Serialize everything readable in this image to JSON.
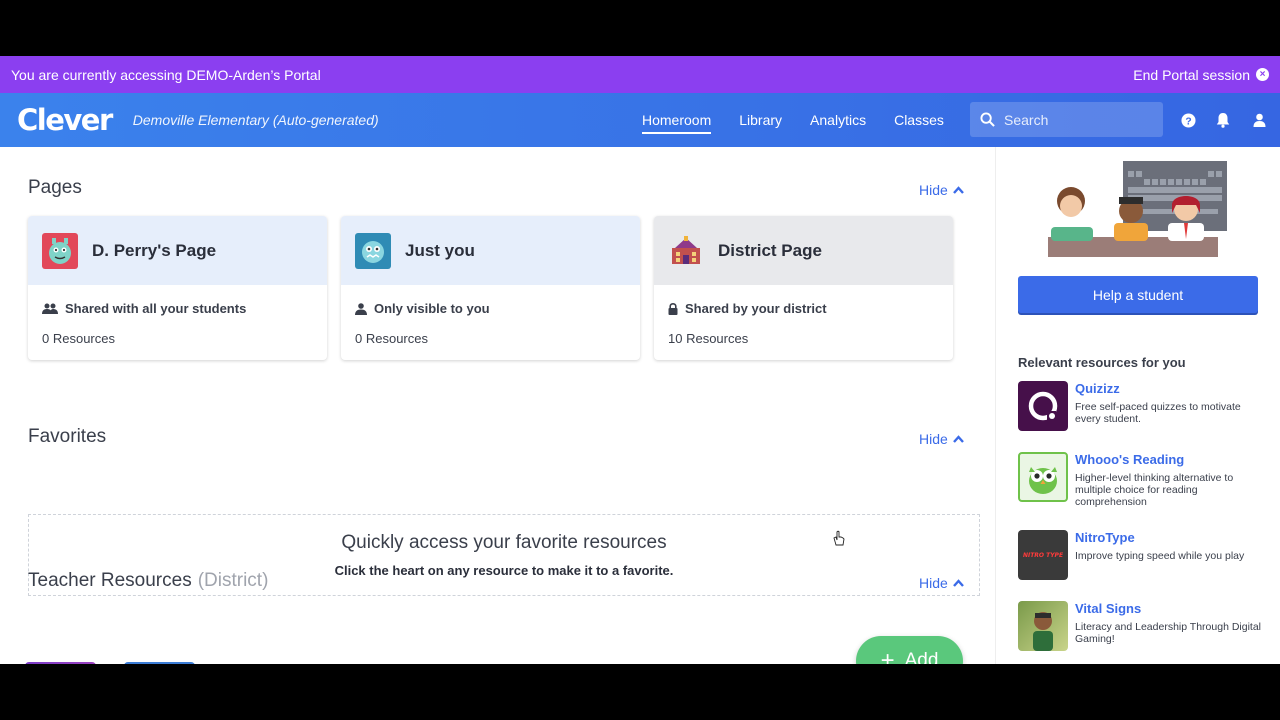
{
  "portal_bar": {
    "message": "You are currently accessing DEMO-Arden’s Portal",
    "end_label": "End Portal session"
  },
  "navbar": {
    "logo": "Clever",
    "district": "Demoville Elementary (Auto-generated)",
    "links": [
      "Homeroom",
      "Library",
      "Analytics",
      "Classes"
    ],
    "active_link": "Homeroom",
    "search_placeholder": "Search",
    "icons": [
      "help-icon",
      "bell-icon",
      "user-icon"
    ]
  },
  "pages": {
    "title": "Pages",
    "hide_label": "Hide",
    "cards": [
      {
        "title": "D. Perry's Page",
        "visibility": "Shared with all your students",
        "resources": "0 Resources",
        "icon": "monster-avatar-icon",
        "accent": "#e6eefb"
      },
      {
        "title": "Just you",
        "visibility": "Only visible to you",
        "resources": "0 Resources",
        "icon": "monster-avatar-icon",
        "accent": "#e6eefb"
      },
      {
        "title": "District Page",
        "visibility": "Shared by your district",
        "resources": "10 Resources",
        "icon": "school-building-icon",
        "accent": "#e8e9ec"
      }
    ]
  },
  "favorites": {
    "title": "Favorites",
    "hide_label": "Hide",
    "empty_title": "Quickly access your favorite resources",
    "empty_hint": "Click the heart on any resource to make it to a favorite."
  },
  "teacher_resources": {
    "title": "Teacher Resources",
    "subtitle": "(District)",
    "hide_label": "Hide"
  },
  "add_button": {
    "label": "Add"
  },
  "sidebar": {
    "help_button": "Help a student",
    "relevant_title": "Relevant resources for you",
    "resources": [
      {
        "name": "Quizizz",
        "desc": "Free self-paced quizzes to motivate every student.",
        "color": "#46104a"
      },
      {
        "name": "Whooo's Reading",
        "desc": "Higher-level thinking alternative to multiple choice for reading comprehension",
        "color": "#6fc24a"
      },
      {
        "name": "NitroType",
        "desc": "Improve typing speed while you play",
        "color": "#3a3a3a",
        "icon_text": "NITRO TYPE"
      },
      {
        "name": "Vital Signs",
        "desc": "Literacy and Leadership Through Digital Gaming!",
        "color": "#7a9a4a"
      }
    ]
  },
  "colors": {
    "portal_bar": "#8b3ff0",
    "navbar": "#3b6be8",
    "link": "#3b6be8",
    "add": "#5ac87c"
  }
}
